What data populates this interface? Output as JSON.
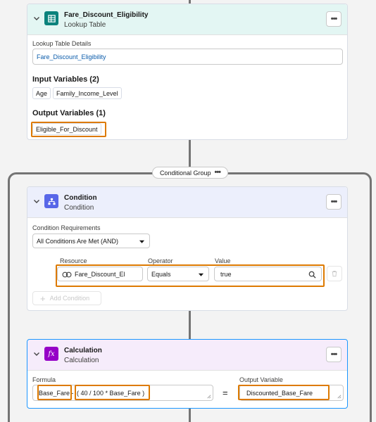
{
  "lookup": {
    "title": "Fare_Discount_Eligibility",
    "subtitle": "Lookup Table",
    "details_label": "Lookup Table Details",
    "details_value": "Fare_Discount_Eligibility",
    "input_title": "Input Variables (2)",
    "inputs": [
      "Age",
      "Family_Income_Level"
    ],
    "output_title": "Output Variables (1)",
    "output": "Eligible_For_Discount",
    "accent": "#0b827c"
  },
  "group": {
    "label": "Conditional Group",
    "dots": "•••"
  },
  "condition": {
    "title": "Condition",
    "subtitle": "Condition",
    "req_label": "Condition Requirements",
    "req_value": "All Conditions Are Met (AND)",
    "resource_label": "Resource",
    "operator_label": "Operator",
    "value_label": "Value",
    "resource_value": "Fare_Discount_El",
    "operator_value": "Equals",
    "value_value": "true",
    "add_label": "Add Condition",
    "accent": "#5867e8"
  },
  "calculation": {
    "title": "Calculation",
    "subtitle": "Calculation",
    "formula_label": "Formula",
    "formula_part1": "Base_Fare",
    "formula_part2": " - ",
    "formula_part3": "( 40 / 100 * Base_Fare )",
    "equals": "=",
    "output_label": "Output Variable",
    "output_value": "Discounted_Base_Fare",
    "accent": "#9602c7"
  },
  "menu_dots": "•••",
  "highlight_color": "#dd7a01"
}
